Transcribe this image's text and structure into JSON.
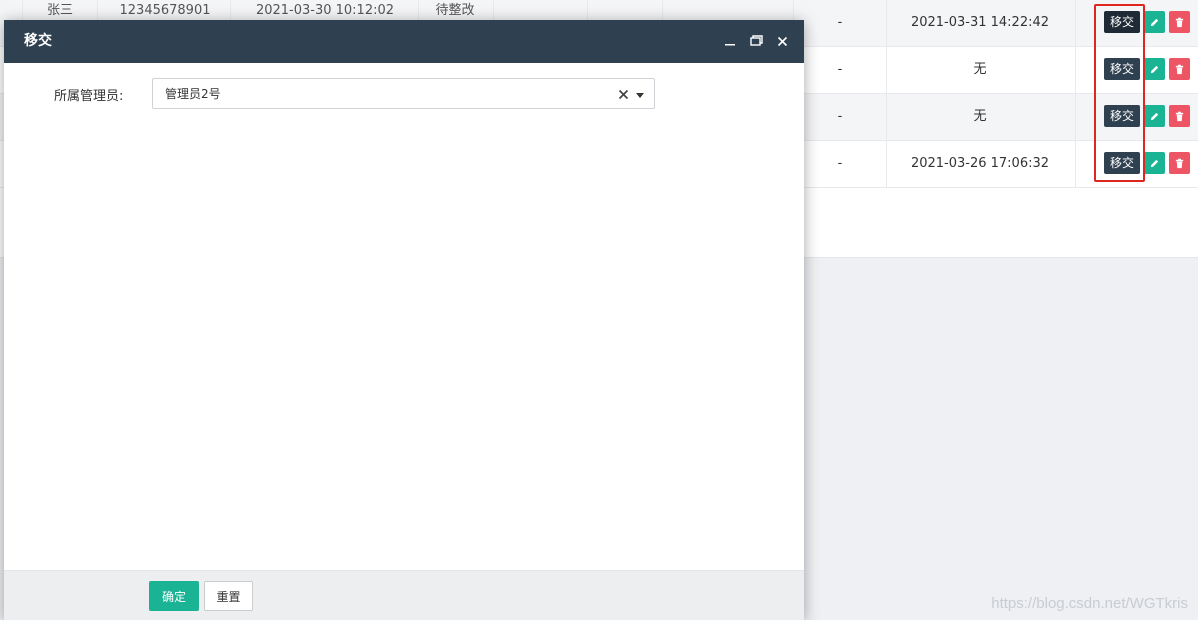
{
  "background_table": {
    "rows": [
      {
        "name_peek": "张三",
        "phone_peek": "12345678901",
        "time_peek": "2021-03-30 10:12:02",
        "status_peek": "待整改",
        "dash": "-",
        "last_time": "2021-03-31 14:22:42",
        "transfer_label": "移交"
      },
      {
        "dash": "-",
        "last_time": "无",
        "transfer_label": "移交"
      },
      {
        "dash": "-",
        "last_time": "无",
        "transfer_label": "移交"
      },
      {
        "dash": "-",
        "last_time": "2021-03-26 17:06:32",
        "transfer_label": "移交"
      }
    ]
  },
  "modal": {
    "title": "移交",
    "form": {
      "admin_label": "所属管理员:",
      "admin_value": "管理员2号"
    },
    "footer": {
      "ok_label": "确定",
      "reset_label": "重置"
    }
  },
  "icons": {
    "minimize": "minimize-icon",
    "maximize": "maximize-icon",
    "close": "close-icon",
    "clear": "clear-icon",
    "caret": "caret-down-icon",
    "edit": "pencil-icon",
    "delete": "trash-icon"
  },
  "colors": {
    "header": "#2f4050",
    "primary": "#1ab394",
    "danger": "#ed5565",
    "highlight": "#e0261f"
  },
  "watermark": "https://blog.csdn.net/WGTkris"
}
